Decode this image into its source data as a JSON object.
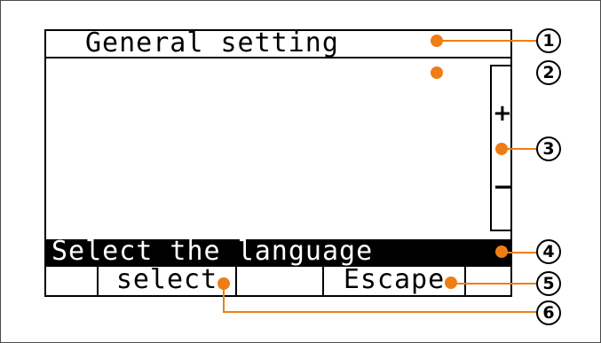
{
  "screen": {
    "title": "General setting",
    "scroll": {
      "up_label": "+",
      "down_label": "−"
    },
    "status": "Select the language",
    "softkeys": [
      "",
      "select",
      "",
      "Escape",
      ""
    ]
  },
  "callouts": [
    "1",
    "2",
    "3",
    "4",
    "5",
    "6"
  ],
  "colors": {
    "accent": "#ef7d16",
    "line": "#000000",
    "screen_bg": "#ffffff",
    "status_bg": "#000000"
  }
}
